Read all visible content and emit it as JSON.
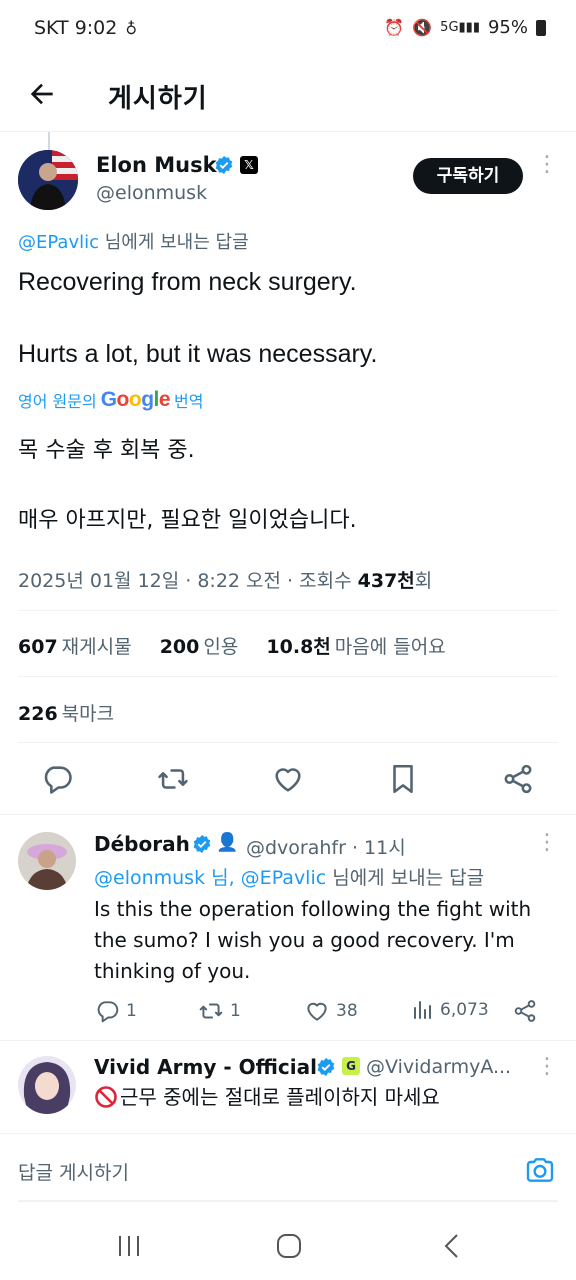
{
  "status_bar": {
    "carrier_time": "SKT 9:02",
    "battery": "95%"
  },
  "header": {
    "title": "게시하기"
  },
  "main_tweet": {
    "author_name": "Elon Musk",
    "author_handle": "@elonmusk",
    "subscribe_label": "구독하기",
    "reply_to_mention": "@EPavlic",
    "reply_to_suffix": " 님에게 보내는 답글",
    "text_line1": "Recovering from neck surgery.",
    "text_line2": "Hurts a lot, but it was necessary.",
    "translate_prefix": "영어 원문의",
    "translate_google": "Google",
    "translate_suffix": "번역",
    "translated_line1": "목 수술 후 회복 중.",
    "translated_line2": "매우 아프지만, 필요한 일이었습니다.",
    "meta_text": "2025년 01월 12일 · 8:22 오전 · 조회수 ",
    "views": "437천",
    "views_suffix": "회",
    "reposts_count": "607",
    "reposts_label": "재게시물",
    "quotes_count": "200",
    "quotes_label": "인용",
    "likes_count": "10.8천",
    "likes_label": "마음에 들어요",
    "bookmarks_count": "226",
    "bookmarks_label": "북마크"
  },
  "replies": [
    {
      "name": "Déborah",
      "handle": "@dvorahfr · 11시",
      "mention_part1": "@elonmusk 님, @EPavlic",
      "mention_part2": " 님에게 보내는 답글",
      "text": "Is this the operation following the fight with the sumo? I wish you a good recovery. I'm thinking of you.",
      "replies": "1",
      "reposts": "1",
      "likes": "38",
      "views": "6,073"
    },
    {
      "name": "Vivid Army - Official",
      "handle": "@VividarmyA...",
      "text": "근무 중에는 절대로 플레이하지 마세요"
    }
  ],
  "composer": {
    "placeholder": "답글 게시하기"
  },
  "colors": {
    "accent": "#1d9bf0",
    "text": "#0f1419",
    "secondary": "#536471"
  }
}
